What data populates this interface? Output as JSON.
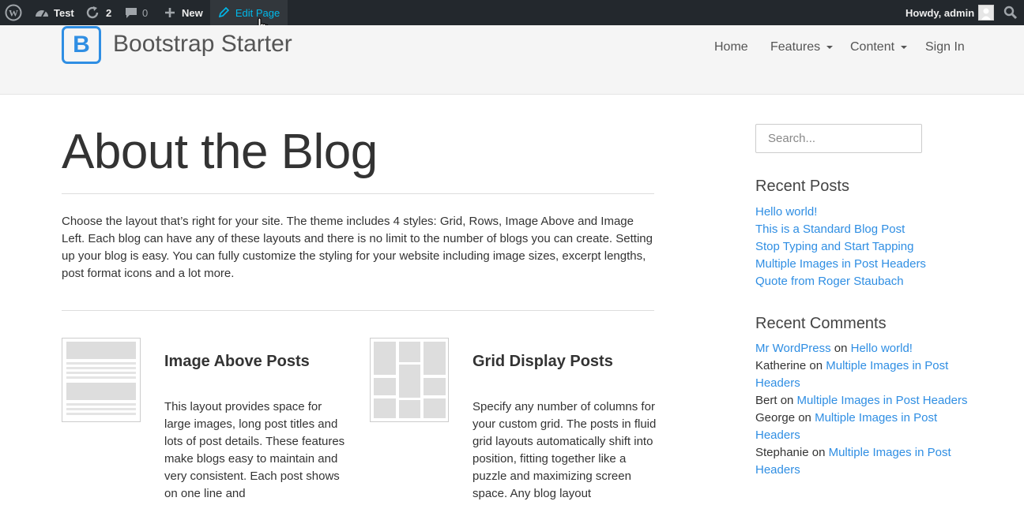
{
  "admin_bar": {
    "site_name": "Test",
    "updates_count": "2",
    "comments_count": "0",
    "new_label": "New",
    "edit_label": "Edit Page",
    "howdy": "Howdy, admin"
  },
  "header": {
    "logo_letter": "B",
    "brand": "Bootstrap Starter",
    "nav": [
      {
        "label": "Home",
        "dropdown": false
      },
      {
        "label": "Features",
        "dropdown": true
      },
      {
        "label": "Content",
        "dropdown": true
      },
      {
        "label": "Sign In",
        "dropdown": false
      }
    ]
  },
  "main": {
    "title": "About the Blog",
    "intro": "Choose the layout that’s right for your site. The theme includes 4 styles: Grid, Rows, Image Above and Image Left. Each blog can have any of these layouts and there is no limit to the number of blogs you can create. Setting up your blog is easy. You can fully customize the styling for your website including image sizes, excerpt lengths, post format icons and a lot more.",
    "features": [
      {
        "title": "Image Above Posts",
        "text": "This layout provides space for large images, long post titles and lots of post details. These features make blogs easy to maintain and very consistent. Each post shows on one line and"
      },
      {
        "title": "Grid Display Posts",
        "text": "Specify any number of columns for your custom grid. The posts in fluid grid layouts automatically shift into position, fitting together like a puzzle and maximizing screen space. Any blog layout"
      }
    ]
  },
  "sidebar": {
    "search_placeholder": "Search...",
    "recent_posts_title": "Recent Posts",
    "recent_posts": [
      "Hello world!",
      "This is a Standard Blog Post",
      "Stop Typing and Start Tapping",
      "Multiple Images in Post Headers",
      "Quote from Roger Staubach"
    ],
    "recent_comments_title": "Recent Comments",
    "on_word": "on",
    "recent_comments": [
      {
        "author": "Mr WordPress",
        "author_link": true,
        "post": "Hello world!"
      },
      {
        "author": "Katherine",
        "author_link": false,
        "post": "Multiple Images in Post Headers"
      },
      {
        "author": "Bert",
        "author_link": false,
        "post": "Multiple Images in Post Headers"
      },
      {
        "author": "George",
        "author_link": false,
        "post": "Multiple Images in Post Headers"
      },
      {
        "author": "Stephanie",
        "author_link": false,
        "post": "Multiple Images in Post Headers"
      }
    ]
  },
  "colors": {
    "admin_bar_bg": "#23282d",
    "accent_link": "#2f8ee3",
    "edit_link": "#00b9eb",
    "header_bg": "#f5f5f5"
  }
}
